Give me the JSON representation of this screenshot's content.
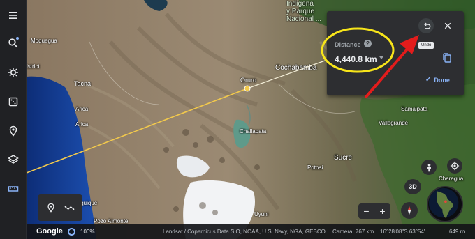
{
  "rail": {
    "items": [
      {
        "name": "menu-icon"
      },
      {
        "name": "search-icon"
      },
      {
        "name": "voyager-icon"
      },
      {
        "name": "feeling-lucky-icon"
      },
      {
        "name": "projects-icon"
      },
      {
        "name": "map-style-icon"
      },
      {
        "name": "measure-distance-icon"
      }
    ]
  },
  "map_labels": {
    "moquegua": "Moquegua",
    "istrict": "istrict",
    "tacna": "Tacna",
    "arica1": "Arica",
    "arica2": "Arica",
    "iquique": "Iquique",
    "pozo_almonte": "Pozo Almonte",
    "oruro": "Oruro",
    "challapata": "Challapata",
    "cochabamba": "Cochabamba",
    "sucre": "Sucre",
    "potosi": "Potosí",
    "uyuni": "Uyuni",
    "samaipata": "Samaipata",
    "vallegrande": "Vallegrande",
    "charagua": "Charagua",
    "indigena_line1": "Indígena",
    "indigena_line2": "y Parque",
    "indigena_line3": "Nacional ..."
  },
  "measure_panel": {
    "distance_label": "Distance",
    "help_glyph": "?",
    "distance_value": "4,440.8 km",
    "undo_tooltip": "Undo",
    "done_label": "Done"
  },
  "statusbar": {
    "brand": "Google",
    "zoom": "100%",
    "credits": "Landsat / Copernicus   Data SIO, NOAA, U.S. Navy, NGA, GEBCO",
    "camera": "Camera: 767 km",
    "coords": "16°28'08\"S 63°54'",
    "elevation": "649 m"
  },
  "controls": {
    "btn_3d": "3D",
    "zoom_in": "+",
    "zoom_out": "−"
  },
  "colors": {
    "panel_bg": "#2d2e31",
    "accent_blue": "#8ab4f8",
    "annotation_yellow": "#f7e51a",
    "annotation_red": "#e31c1c",
    "measure_line": "#f2c94c"
  }
}
